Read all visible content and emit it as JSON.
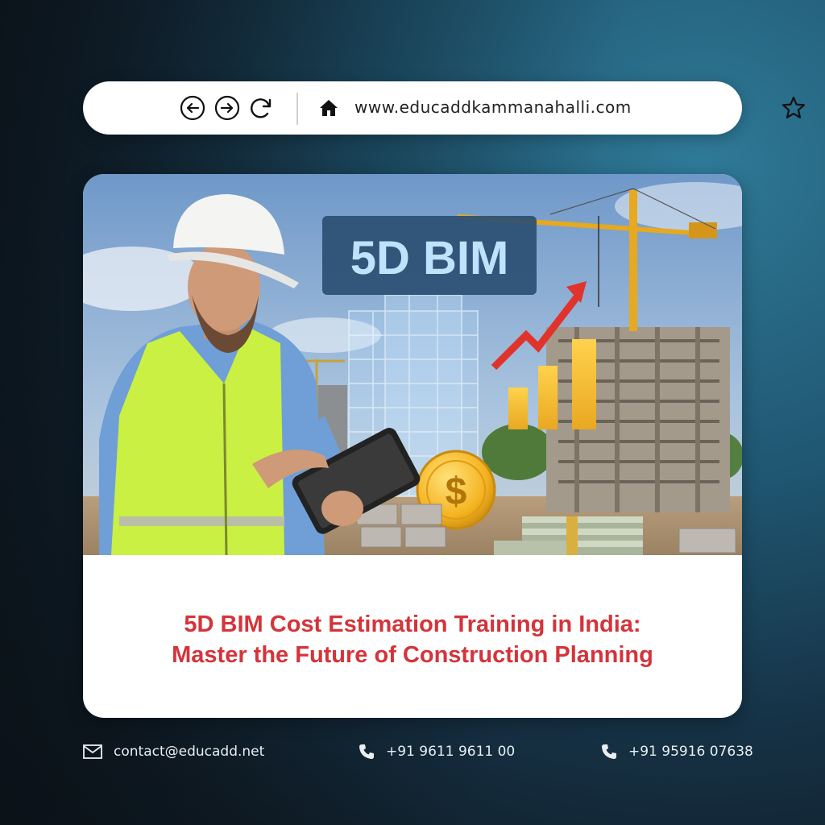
{
  "browser": {
    "url": "www.educaddkammanahalli.com",
    "back_icon": "arrow-left-circle-icon",
    "forward_icon": "arrow-right-circle-icon",
    "reload_icon": "reload-icon",
    "home_icon": "home-icon",
    "bookmark_icon": "star-icon"
  },
  "hero": {
    "badge_text": "5D BIM"
  },
  "headline": {
    "line1": "5D BIM Cost Estimation Training in India:",
    "line2": "Master the Future of Construction Planning"
  },
  "footer": {
    "email": "contact@educadd.net",
    "phone1": "+91 9611 9611 00",
    "phone2": "+91 95916 07638"
  },
  "colors": {
    "headline": "#d4343a",
    "background": "#163246",
    "badge_bg": "#2a4f72",
    "badge_text": "#bfe2ff"
  }
}
